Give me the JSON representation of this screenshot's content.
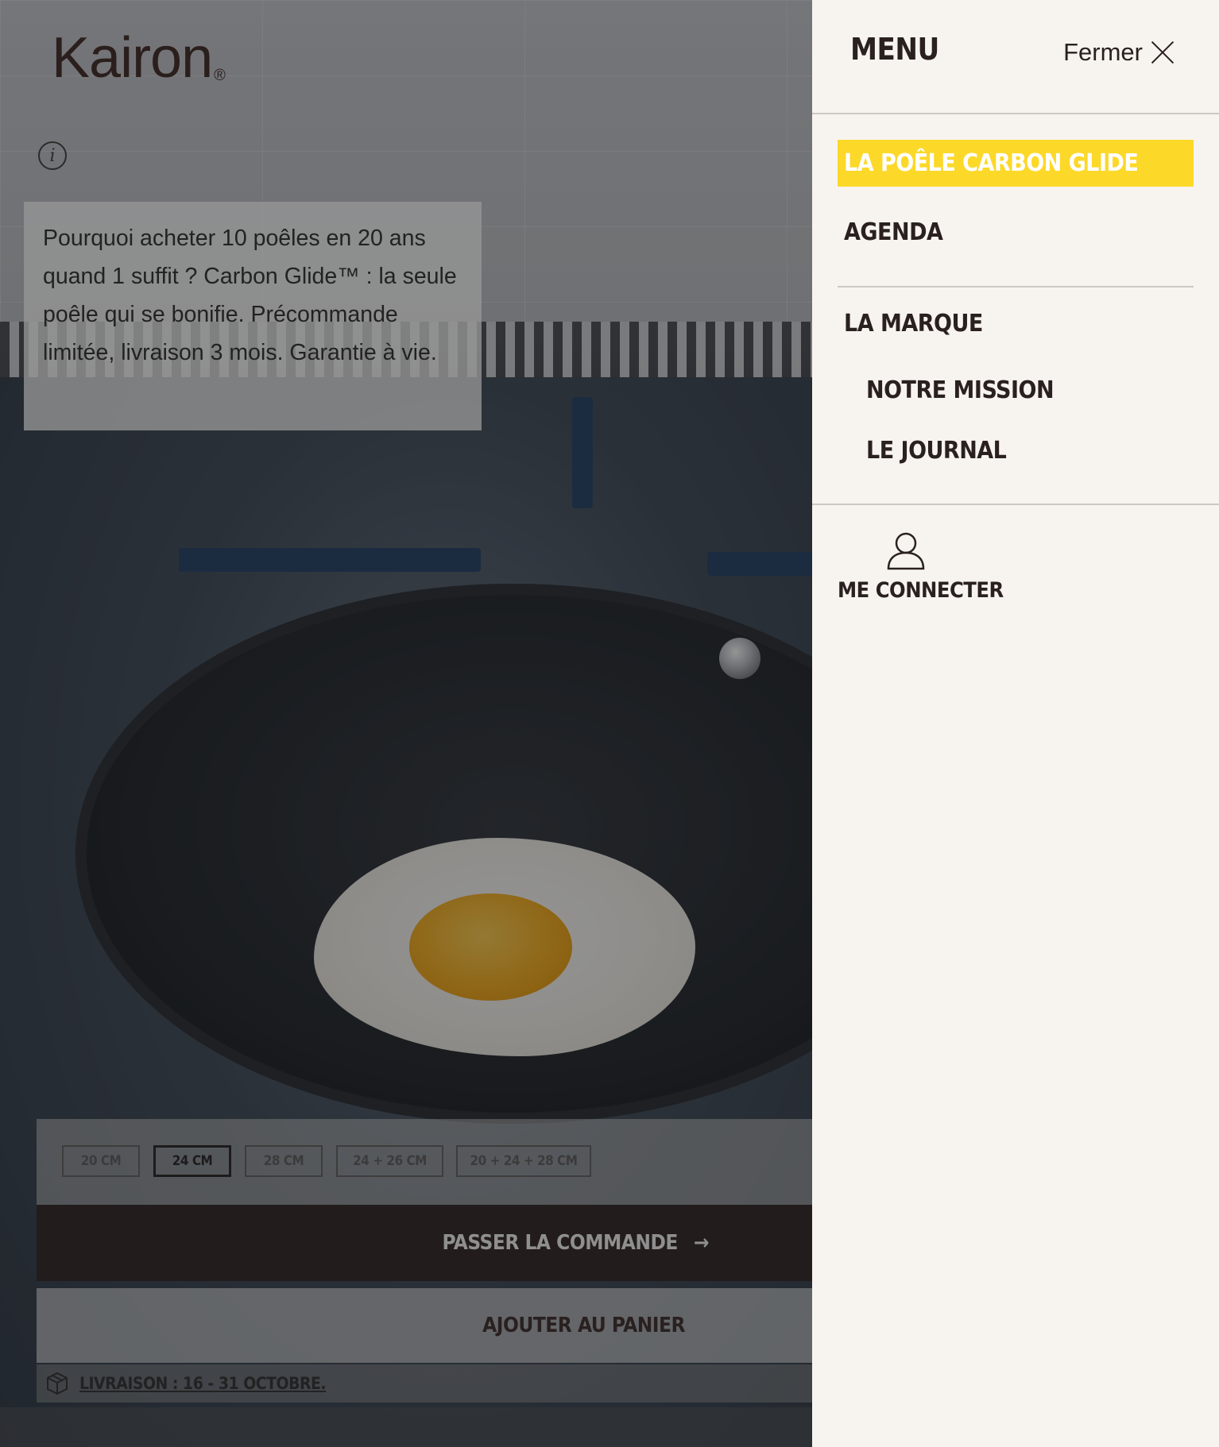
{
  "brand": {
    "logo_text": "Kairon",
    "logo_mark": "®"
  },
  "promo": {
    "text": "Pourquoi acheter 10 poêles en 20 ans quand 1 suffit ? Carbon Glide™ : la seule poêle qui se bonifie. Précommande limitée, livraison 3 mois. Garantie à vie."
  },
  "sizes": {
    "options": [
      "20 CM",
      "24 CM",
      "28 CM",
      "24 + 26 CM",
      "20 + 24 + 28 CM"
    ],
    "selected": "24 CM"
  },
  "actions": {
    "order_label": "PASSER LA COMMANDE",
    "cart_label": "AJOUTER AU PANIER",
    "delivery_label": "LIVRAISON : 16 - 31 OCTOBRE."
  },
  "menu": {
    "title": "MENU",
    "close_label": "Fermer",
    "items": [
      {
        "label": "LA POÊLE CARBON GLIDE",
        "active": true
      },
      {
        "label": "AGENDA"
      },
      {
        "label": "LA MARQUE"
      },
      {
        "label": "NOTRE MISSION"
      },
      {
        "label": "LE JOURNAL"
      }
    ],
    "login_label": "ME CONNECTER"
  },
  "colors": {
    "accent_yellow": "#fcd829",
    "dark_brown": "#231c1c",
    "panel_bg": "#f7f4f0"
  },
  "icons": [
    "info-icon",
    "arrow-right-icon",
    "package-icon",
    "close-icon",
    "user-icon"
  ]
}
